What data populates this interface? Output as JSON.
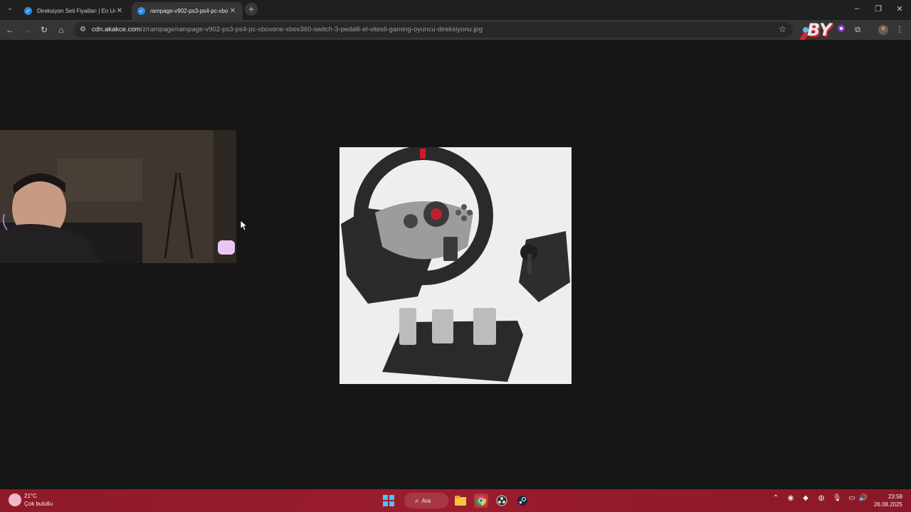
{
  "browser": {
    "tabs": [
      {
        "title": "Direksiyon Seti Fiyatları | En Uc",
        "active": false
      },
      {
        "title": "rampage-v902-ps3-ps4-pc-xbo",
        "active": true
      }
    ],
    "url_host": "cdn.akakce.com",
    "url_path": "/z/rampage/rampage-v902-ps3-ps4-pc-xboxone-xbox360-switch-3-pedalli-el-vitesli-gaming-oyuncu-direksiyonu.jpg",
    "accent": "#2f8ae0"
  },
  "overlay": {
    "logo_text": "BY"
  },
  "taskbar": {
    "weather_temp": "21°C",
    "weather_desc": "Çok bulutlu",
    "search_label": "Ara",
    "time": "23:58",
    "date": "26.08.2025",
    "color": "#9b1c2d"
  },
  "icons": {
    "tab_list": "chevron-down-icon",
    "back": "arrow-left-icon",
    "forward": "arrow-right-icon",
    "reload": "reload-icon",
    "home": "home-icon",
    "bookmark": "star-icon",
    "extensions": "puzzle-icon"
  }
}
